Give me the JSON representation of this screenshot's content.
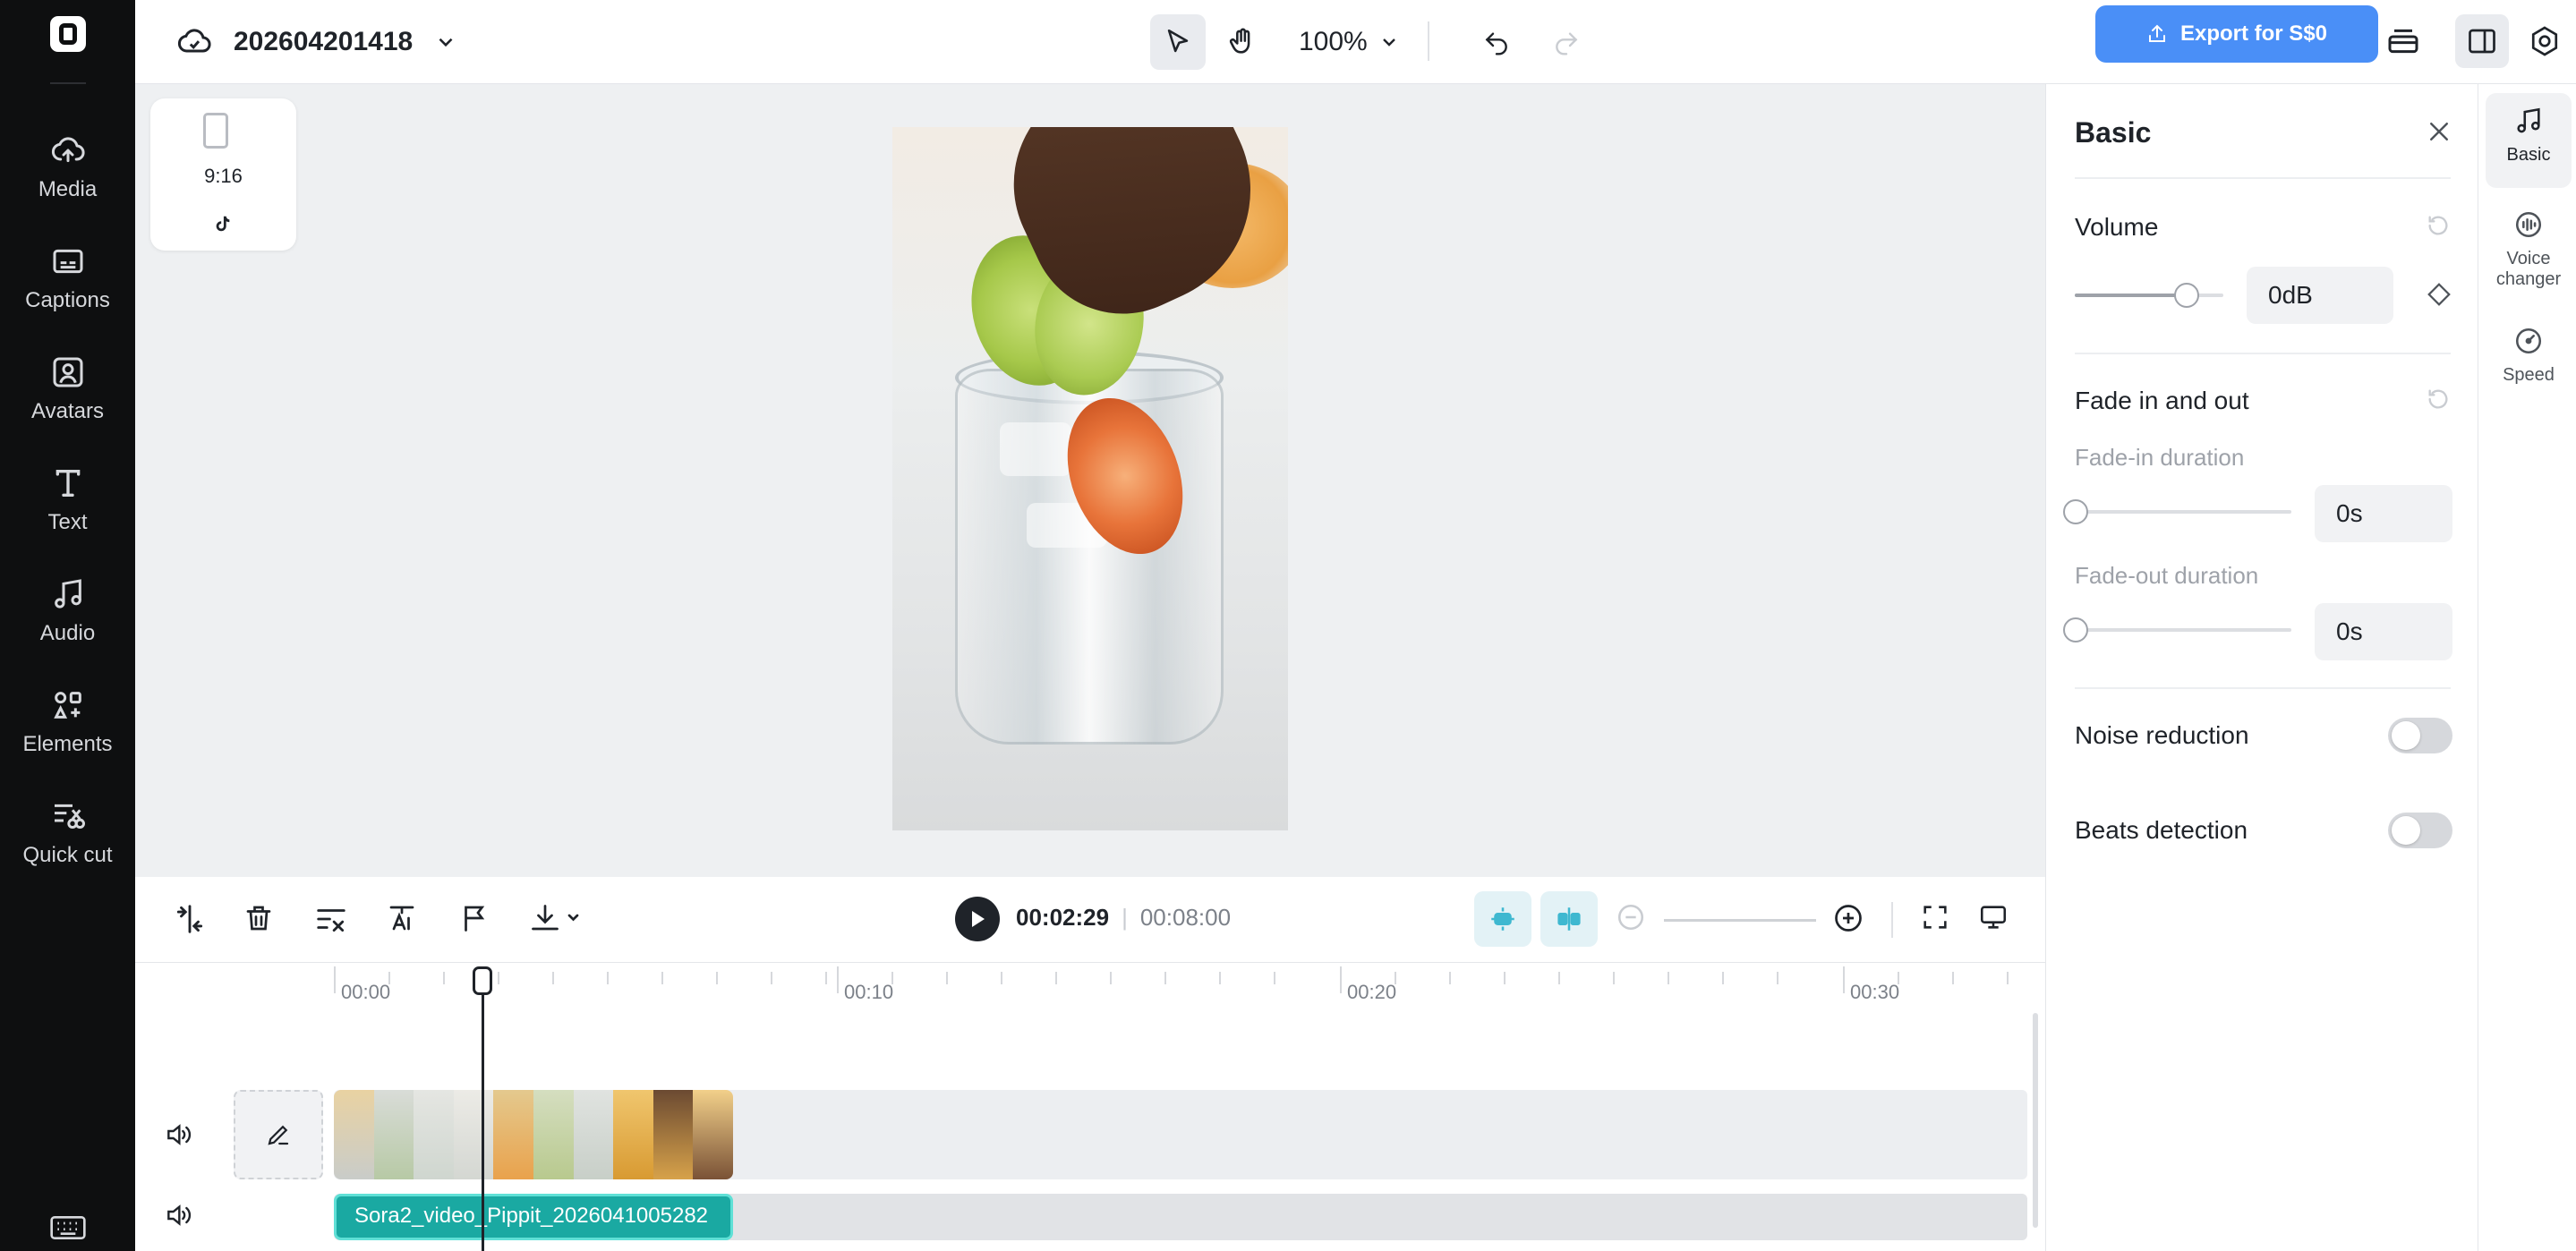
{
  "rail": {
    "items": [
      {
        "label": "Media",
        "icon": "cloud-upload-icon"
      },
      {
        "label": "Captions",
        "icon": "captions-icon"
      },
      {
        "label": "Avatars",
        "icon": "avatar-icon"
      },
      {
        "label": "Text",
        "icon": "text-icon"
      },
      {
        "label": "Audio",
        "icon": "music-note-icon"
      },
      {
        "label": "Elements",
        "icon": "elements-icon"
      },
      {
        "label": "Quick cut",
        "icon": "quick-cut-icon"
      }
    ]
  },
  "header": {
    "project_name": "202604201418",
    "zoom": "100%",
    "export_label": "Export for S$0"
  },
  "canvas": {
    "aspect_ratio": "9:16"
  },
  "panel": {
    "title": "Basic",
    "volume_label": "Volume",
    "volume_value": "0dB",
    "fade_label": "Fade in and out",
    "fade_in_label": "Fade-in duration",
    "fade_in_value": "0s",
    "fade_out_label": "Fade-out duration",
    "fade_out_value": "0s",
    "noise_label": "Noise reduction",
    "beats_label": "Beats detection"
  },
  "side_tabs": [
    {
      "label": "Basic",
      "icon": "music-note-icon",
      "active": true
    },
    {
      "label": "Voice changer",
      "icon": "voice-changer-icon",
      "active": false
    },
    {
      "label": "Speed",
      "icon": "speed-icon",
      "active": false
    }
  ],
  "timeline": {
    "current_time": "00:02:29",
    "total_time": "00:08:00",
    "ruler": [
      "00:00",
      "00:10",
      "00:20",
      "00:30"
    ],
    "audio_clip_name": "Sora2_video_Pippit_2026041005282"
  },
  "colors": {
    "accent": "#4a8ff7",
    "audio_clip": "#1aa9a2",
    "rail_bg": "#0e0f10"
  }
}
